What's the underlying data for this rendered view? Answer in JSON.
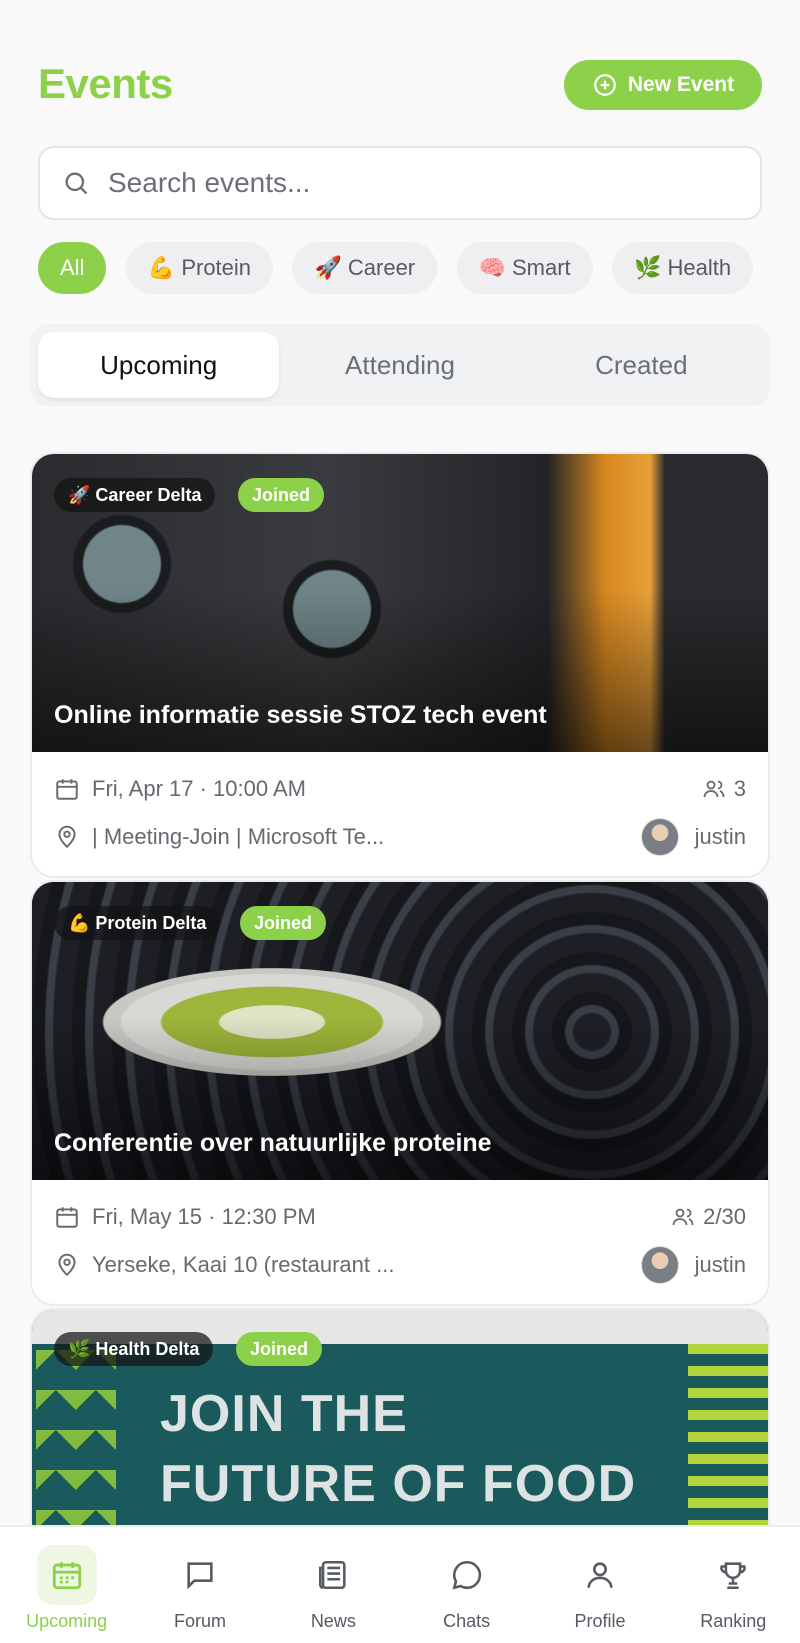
{
  "header": {
    "title": "Events",
    "new_event_label": "New Event"
  },
  "search": {
    "placeholder": "Search events..."
  },
  "filters": [
    {
      "emoji": "",
      "label": "All",
      "active": true
    },
    {
      "emoji": "💪",
      "label": "Protein"
    },
    {
      "emoji": "🚀",
      "label": "Career"
    },
    {
      "emoji": "🧠",
      "label": "Smart"
    },
    {
      "emoji": "🌿",
      "label": "Health"
    }
  ],
  "tabs": [
    "Upcoming",
    "Attending",
    "Created"
  ],
  "events": [
    {
      "category": "🚀 Career Delta",
      "status": "Joined",
      "title": "Online informatie sessie STOZ tech event",
      "datetime": "Fri, Apr 17 · 10:00 AM",
      "attendees": "3",
      "location": "| Meeting-Join | Microsoft Te...",
      "host": "justin"
    },
    {
      "category": "💪 Protein Delta",
      "status": "Joined",
      "title": "Conferentie over natuurlijke proteine",
      "datetime": "Fri, May 15 · 12:30 PM",
      "attendees": "2/30",
      "location": "Yerseke, Kaai 10 (restaurant ...",
      "host": "justin"
    },
    {
      "category": "🌿 Health Delta",
      "status": "Joined",
      "banner_line1": "JOIN THE",
      "banner_line2": "FUTURE OF FOOD"
    }
  ],
  "nav": {
    "upcoming": "Upcoming",
    "forum": "Forum",
    "news": "News",
    "chats": "Chats",
    "profile": "Profile",
    "ranking": "Ranking"
  },
  "colors": {
    "accent": "#8dd14a",
    "text_muted": "#666a70"
  }
}
